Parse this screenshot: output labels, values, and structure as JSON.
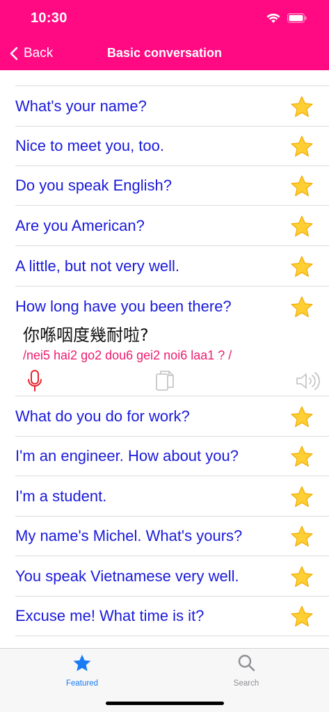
{
  "status_bar": {
    "time": "10:30"
  },
  "nav": {
    "back_label": "Back",
    "title": "Basic conversation"
  },
  "phrases": [
    {
      "text": "What's your name?"
    },
    {
      "text": "Nice to meet you, too."
    },
    {
      "text": "Do you speak English?"
    },
    {
      "text": "Are you American?"
    },
    {
      "text": "A little, but not very well."
    }
  ],
  "expanded": {
    "text": "How long have you been there?",
    "translation": "你喺咽度幾耐啦?",
    "romanization": "/nei5 hai2 go2 dou6 gei2 noi6 laa1 ?  /"
  },
  "phrases_after": [
    {
      "text": "What do you do for work?"
    },
    {
      "text": "I'm an engineer. How about you?"
    },
    {
      "text": "I'm a student."
    },
    {
      "text": "My name's Michel. What's yours?"
    },
    {
      "text": "You speak Vietnamese very well."
    },
    {
      "text": "Excuse me! What time is it?"
    }
  ],
  "tabs": [
    {
      "label": "Featured",
      "icon": "star-icon",
      "selected": true
    },
    {
      "label": "Search",
      "icon": "search-icon",
      "selected": false
    }
  ],
  "colors": {
    "header": "#ff0a82",
    "phrase_text": "#1a1adb",
    "romanization": "#ec1c6e",
    "tab_selected": "#1a7cf5",
    "tab_unselected": "#8e8e93"
  }
}
